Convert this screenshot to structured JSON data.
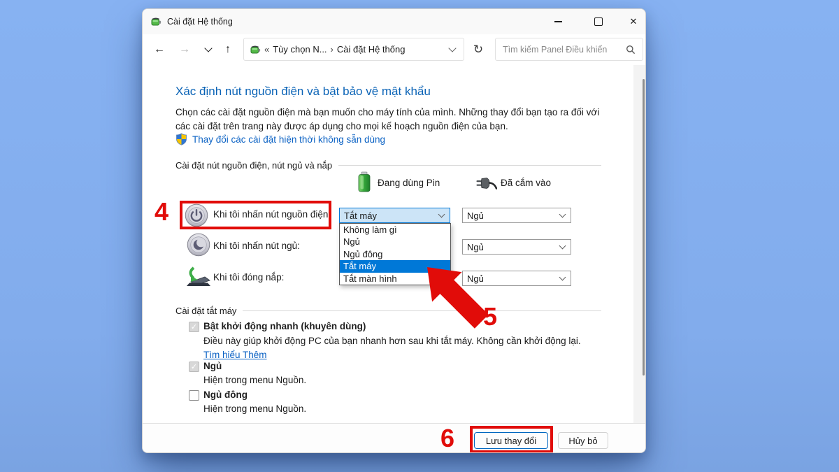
{
  "window": {
    "title": "Cài đặt Hệ thống"
  },
  "icons": {
    "back": "←",
    "forward": "→",
    "up": "↑",
    "refresh": "↻",
    "close": "✕",
    "breadcrumb_chevrons": "«",
    "breadcrumb_separator": "›",
    "check": "✓"
  },
  "toolbar": {
    "breadcrumb_truncated": "Tùy chọn N...",
    "breadcrumb_current": "Cài đặt Hệ thống",
    "search_placeholder": "Tìm kiếm Panel Điều khiển"
  },
  "page": {
    "heading": "Xác định nút nguồn điện và bật bảo vệ mật khẩu",
    "intro": "Chọn các cài đặt nguồn điện mà bạn muốn cho máy tính của mình. Những thay đổi bạn tạo ra đối với các cài đặt trên trang này được áp dụng cho mọi kế hoạch nguồn điện của bạn.",
    "uac_link": "Thay đổi các cài đặt hiện thời không sẵn dùng",
    "section_buttons": "Cài đặt nút nguồn điện, nút ngủ và nắp",
    "col_on_battery": "Đang dùng Pin",
    "col_plugged_in": "Đã cắm vào",
    "row_power_label": "Khi tôi nhấn nút nguồn điện:",
    "row_sleep_label": "Khi tôi nhấn nút ngủ:",
    "row_lid_label": "Khi tôi đóng nắp:",
    "combo_power_battery_value": "Tắt máy",
    "combo_power_plugged_value": "Ngủ",
    "combo_sleep_plugged_value": "Ngủ",
    "combo_lid_plugged_value": "Ngủ",
    "dropdown_options": [
      "Không làm gì",
      "Ngủ",
      "Ngủ đông",
      "Tắt máy",
      "Tắt màn hình"
    ],
    "dropdown_selected": "Tắt máy",
    "section_shutdown": "Cài đặt tắt máy",
    "fast_startup_label": "Bật khởi động nhanh (khuyên dùng)",
    "fast_startup_desc": "Điều này giúp khởi động PC của bạn nhanh hơn sau khi tắt máy. Không cần khởi động lại. ",
    "fast_startup_link": "Tìm hiểu Thêm",
    "sleep_label": "Ngủ",
    "sleep_desc": "Hiện trong menu Nguồn.",
    "hibernate_label": "Ngủ đông",
    "hibernate_desc": "Hiện trong menu Nguồn.",
    "save_button": "Lưu thay đổi",
    "cancel_button": "Hủy bỏ"
  },
  "annotations": {
    "step_power_button": "4",
    "step_dropdown": "5",
    "step_save": "6",
    "highlight_color": "#e10c09",
    "selection_color": "#0078d7",
    "heading_color": "#0a63b6",
    "link_color": "#0b62c4"
  }
}
